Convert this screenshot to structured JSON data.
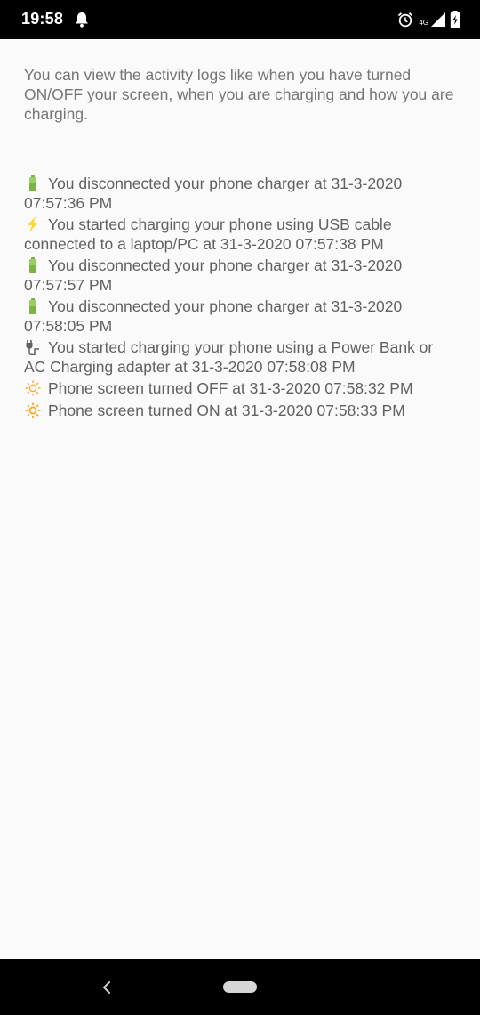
{
  "status_bar": {
    "time": "19:58",
    "network": "4G"
  },
  "intro_text": "You can view the activity logs like when you have turned ON/OFF your screen, when you are charging and how you are charging.",
  "logs": [
    {
      "icon": "battery-icon",
      "text": "You disconnected your phone charger at 31-3-2020 07:57:36 PM"
    },
    {
      "icon": "lightning-icon",
      "text": "You started charging your phone using USB cable connected to a laptop/PC at 31-3-2020 07:57:38 PM"
    },
    {
      "icon": "battery-icon",
      "text": "You disconnected your phone charger at 31-3-2020 07:57:57 PM"
    },
    {
      "icon": "battery-icon",
      "text": "You disconnected your phone charger at 31-3-2020 07:58:05 PM"
    },
    {
      "icon": "plug-icon",
      "text": "You started charging your phone using a Power Bank or AC Charging adapter at 31-3-2020 07:58:08 PM"
    },
    {
      "icon": "sun-off-icon",
      "text": "Phone screen turned OFF at 31-3-2020 07:58:32 PM"
    },
    {
      "icon": "sun-on-icon",
      "text": "Phone screen turned ON at 31-3-2020 07:58:33 PM"
    }
  ],
  "colors": {
    "battery": "#7cb342",
    "lightning": "#fdd835",
    "plug": "#616161",
    "sun": "#f9a825"
  }
}
